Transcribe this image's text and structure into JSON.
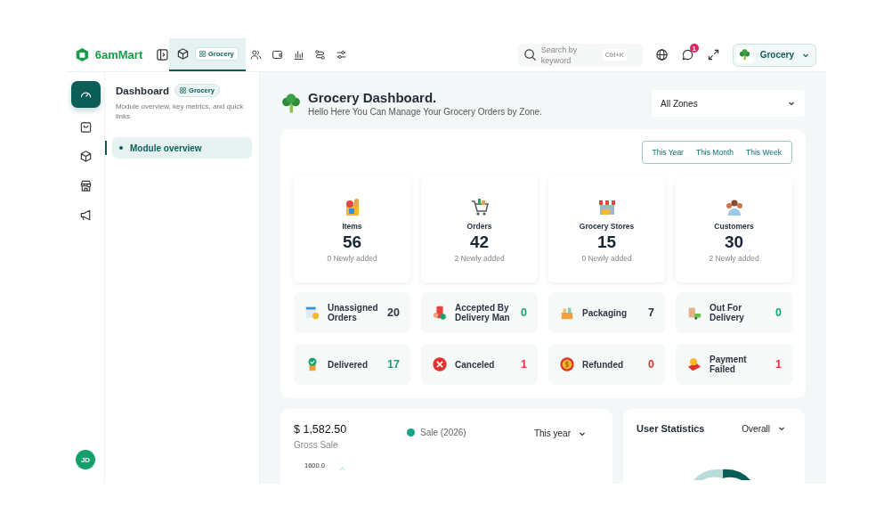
{
  "brand": {
    "name": "6amMart"
  },
  "top_tabs": [
    {
      "kind": "module",
      "badge": "Grocery",
      "selected": true
    },
    {
      "kind": "users",
      "selected": false
    },
    {
      "kind": "wallet",
      "selected": false
    },
    {
      "kind": "chart",
      "selected": false
    },
    {
      "kind": "routes",
      "selected": false
    },
    {
      "kind": "sliders",
      "selected": false
    }
  ],
  "search": {
    "placeholder": "Search by keyword",
    "shortcut": "Ctrl+K"
  },
  "notifications": {
    "count": "1"
  },
  "module_switcher": {
    "label": "Grocery"
  },
  "rail": [
    {
      "kind": "dashboard",
      "selected": true
    },
    {
      "kind": "bag",
      "selected": false
    },
    {
      "kind": "box",
      "selected": false
    },
    {
      "kind": "store",
      "selected": false
    },
    {
      "kind": "megaphone",
      "selected": false
    }
  ],
  "avatar": {
    "initials": "JD"
  },
  "sidebar": {
    "title": "Dashboard",
    "badge": "Grocery",
    "description": "Module overview, key metrics, and quick links",
    "items": [
      {
        "label": "Module overview",
        "selected": true
      }
    ]
  },
  "header": {
    "title": "Grocery Dashboard.",
    "subtitle": "Hello Here You Can Manage Your Grocery Orders by Zone.",
    "zone_select": "All Zones"
  },
  "period_tabs": [
    "This Year",
    "This Month",
    "This Week"
  ],
  "stats": [
    {
      "kind": "items",
      "label": "Items",
      "value": "56",
      "note": "0 Newly added"
    },
    {
      "kind": "orders",
      "label": "Orders",
      "value": "42",
      "note": "2 Newly added"
    },
    {
      "kind": "stores",
      "label": "Grocery Stores",
      "value": "15",
      "note": "0 Newly added"
    },
    {
      "kind": "customers",
      "label": "Customers",
      "value": "30",
      "note": "2 Newly added"
    }
  ],
  "statuses": [
    {
      "kind": "unassigned",
      "label": "Unassigned Orders",
      "value": "20",
      "color": "#2b3440"
    },
    {
      "kind": "accepted",
      "label": "Accepted By Delivery Man",
      "value": "0",
      "color": "#12a46b"
    },
    {
      "kind": "packaging",
      "label": "Packaging",
      "value": "7",
      "color": "#2b3440"
    },
    {
      "kind": "out_for_delivery",
      "label": "Out For Delivery",
      "value": "0",
      "color": "#12a46b"
    },
    {
      "kind": "delivered",
      "label": "Delivered",
      "value": "17",
      "color": "#12a46b"
    },
    {
      "kind": "canceled",
      "label": "Canceled",
      "value": "1",
      "color": "#e0322e"
    },
    {
      "kind": "refunded",
      "label": "Refunded",
      "value": "0",
      "color": "#e0322e"
    },
    {
      "kind": "payment_failed",
      "label": "Payment Failed",
      "value": "1",
      "color": "#e0322e"
    }
  ],
  "sales": {
    "amount": "$ 1,582.50",
    "label": "Gross Sale",
    "legend": {
      "label": "Sale (2026)",
      "color": "#14a38b"
    },
    "period": "This year",
    "tick": "1600.0"
  },
  "user_stats": {
    "title": "User Statistics",
    "period": "Overall"
  }
}
